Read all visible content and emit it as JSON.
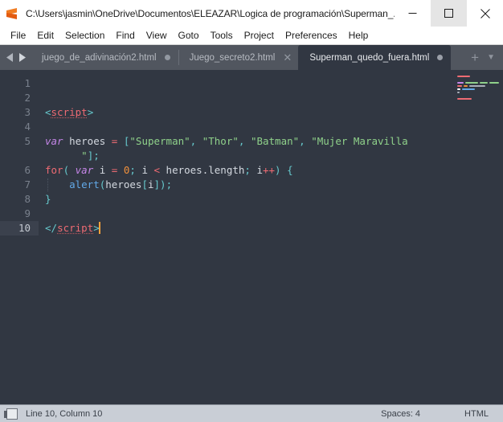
{
  "window": {
    "title": "C:\\Users\\jasmin\\OneDrive\\Documentos\\ELEAZAR\\Logica de programación\\Superman_...",
    "app_icon": "sublime-text-icon",
    "minimize_label": "—",
    "maximize_label": "☐",
    "close_label": "✕",
    "accent_color": "#f7a23b"
  },
  "menubar": {
    "items": [
      {
        "label": "File"
      },
      {
        "label": "Edit"
      },
      {
        "label": "Selection"
      },
      {
        "label": "Find"
      },
      {
        "label": "View"
      },
      {
        "label": "Goto"
      },
      {
        "label": "Tools"
      },
      {
        "label": "Project"
      },
      {
        "label": "Preferences"
      },
      {
        "label": "Help"
      }
    ]
  },
  "tabbar": {
    "nav_prev_icon": "chevron-left-icon",
    "nav_next_icon": "chevron-right-icon",
    "new_tab_label": "+",
    "tab_menu_label": "▼",
    "tabs": [
      {
        "label": "juego_de_adivinación2.html",
        "active": false,
        "modified": true,
        "indicator": "dot"
      },
      {
        "label": "Juego_secreto2.html",
        "active": false,
        "modified": false,
        "indicator": "close"
      },
      {
        "label": "Superman_quedo_fuera.html",
        "active": true,
        "modified": true,
        "indicator": "dot"
      }
    ]
  },
  "editor": {
    "background": "#313742",
    "gutter_lines": [
      "1",
      "2",
      "3",
      "4",
      "5",
      "",
      "6",
      "7",
      "8",
      "9",
      "10"
    ],
    "active_line_number": "10",
    "lines": [
      {
        "n": "1",
        "tokens": []
      },
      {
        "n": "2",
        "tokens": []
      },
      {
        "n": "3",
        "tokens": [
          {
            "t": "<",
            "c": "punct"
          },
          {
            "t": "script",
            "c": "tag"
          },
          {
            "t": ">",
            "c": "punct"
          }
        ]
      },
      {
        "n": "4",
        "tokens": []
      },
      {
        "n": "5",
        "tokens": [
          {
            "t": "var",
            "c": "kw"
          },
          {
            "t": " heroes ",
            "c": "plain"
          },
          {
            "t": "=",
            "c": "op"
          },
          {
            "t": " ",
            "c": "plain"
          },
          {
            "t": "[",
            "c": "punct"
          },
          {
            "t": "\"Superman\"",
            "c": "str"
          },
          {
            "t": ",",
            "c": "punct"
          },
          {
            "t": " ",
            "c": "plain"
          },
          {
            "t": "\"Thor\"",
            "c": "str"
          },
          {
            "t": ",",
            "c": "punct"
          },
          {
            "t": " ",
            "c": "plain"
          },
          {
            "t": "\"Batman\"",
            "c": "str"
          },
          {
            "t": ",",
            "c": "punct"
          },
          {
            "t": " ",
            "c": "plain"
          },
          {
            "t": "\"Mujer Maravilla",
            "c": "str"
          }
        ]
      },
      {
        "n": "",
        "wrap": true,
        "tokens": [
          {
            "t": "      \"",
            "c": "str"
          },
          {
            "t": "]",
            "c": "punct"
          },
          {
            "t": ";",
            "c": "punct"
          }
        ]
      },
      {
        "n": "6",
        "tokens": [
          {
            "t": "for",
            "c": "kw2"
          },
          {
            "t": "(",
            "c": "punct"
          },
          {
            "t": " ",
            "c": "plain"
          },
          {
            "t": "var",
            "c": "kw"
          },
          {
            "t": " i ",
            "c": "plain"
          },
          {
            "t": "=",
            "c": "op"
          },
          {
            "t": " ",
            "c": "plain"
          },
          {
            "t": "0",
            "c": "num"
          },
          {
            "t": ";",
            "c": "punct"
          },
          {
            "t": " i ",
            "c": "plain"
          },
          {
            "t": "<",
            "c": "op"
          },
          {
            "t": " heroes.length",
            "c": "plain"
          },
          {
            "t": ";",
            "c": "punct"
          },
          {
            "t": " i",
            "c": "plain"
          },
          {
            "t": "++",
            "c": "op"
          },
          {
            "t": ")",
            "c": "punct"
          },
          {
            "t": " ",
            "c": "plain"
          },
          {
            "t": "{",
            "c": "punct"
          }
        ]
      },
      {
        "n": "7",
        "indent": true,
        "tokens": [
          {
            "t": "    ",
            "c": "plain"
          },
          {
            "t": "alert",
            "c": "fn"
          },
          {
            "t": "(",
            "c": "punct"
          },
          {
            "t": "heroes",
            "c": "plain"
          },
          {
            "t": "[",
            "c": "punct"
          },
          {
            "t": "i",
            "c": "plain"
          },
          {
            "t": "]",
            "c": "punct"
          },
          {
            "t": ")",
            "c": "punct"
          },
          {
            "t": ";",
            "c": "punct"
          }
        ]
      },
      {
        "n": "8",
        "tokens": [
          {
            "t": "}",
            "c": "punct"
          }
        ]
      },
      {
        "n": "9",
        "tokens": []
      },
      {
        "n": "10",
        "active": true,
        "caret": true,
        "tokens": [
          {
            "t": "<",
            "c": "punct"
          },
          {
            "t": "/",
            "c": "punct"
          },
          {
            "t": "script",
            "c": "tag"
          },
          {
            "t": ">",
            "c": "punct"
          }
        ]
      }
    ]
  },
  "minimap": {
    "name": "code-minimap",
    "rows": [
      {
        "segs": [
          {
            "w": 16,
            "color": "#ef6b73"
          }
        ]
      },
      {
        "segs": []
      },
      {
        "segs": [
          {
            "w": 8,
            "color": "#c586e8"
          },
          {
            "w": 16,
            "color": "#8fd18a"
          },
          {
            "w": 10,
            "color": "#8fd18a"
          },
          {
            "w": 12,
            "color": "#8fd18a"
          }
        ]
      },
      {
        "segs": [
          {
            "w": 6,
            "color": "#ef6b73"
          },
          {
            "w": 5,
            "color": "#f0903c"
          },
          {
            "w": 20,
            "color": "#aab0ba"
          }
        ]
      },
      {
        "segs": [
          {
            "w": 4,
            "color": "#ffffff"
          },
          {
            "w": 16,
            "color": "#62a9e8"
          }
        ]
      },
      {
        "segs": [
          {
            "w": 3,
            "color": "#aab0ba"
          }
        ]
      },
      {
        "segs": []
      },
      {
        "segs": [
          {
            "w": 18,
            "color": "#ef6b73"
          }
        ]
      }
    ]
  },
  "statusbar": {
    "cursor_position": "Line 10, Column 10",
    "spaces": "Spaces: 4",
    "syntax": "HTML"
  }
}
